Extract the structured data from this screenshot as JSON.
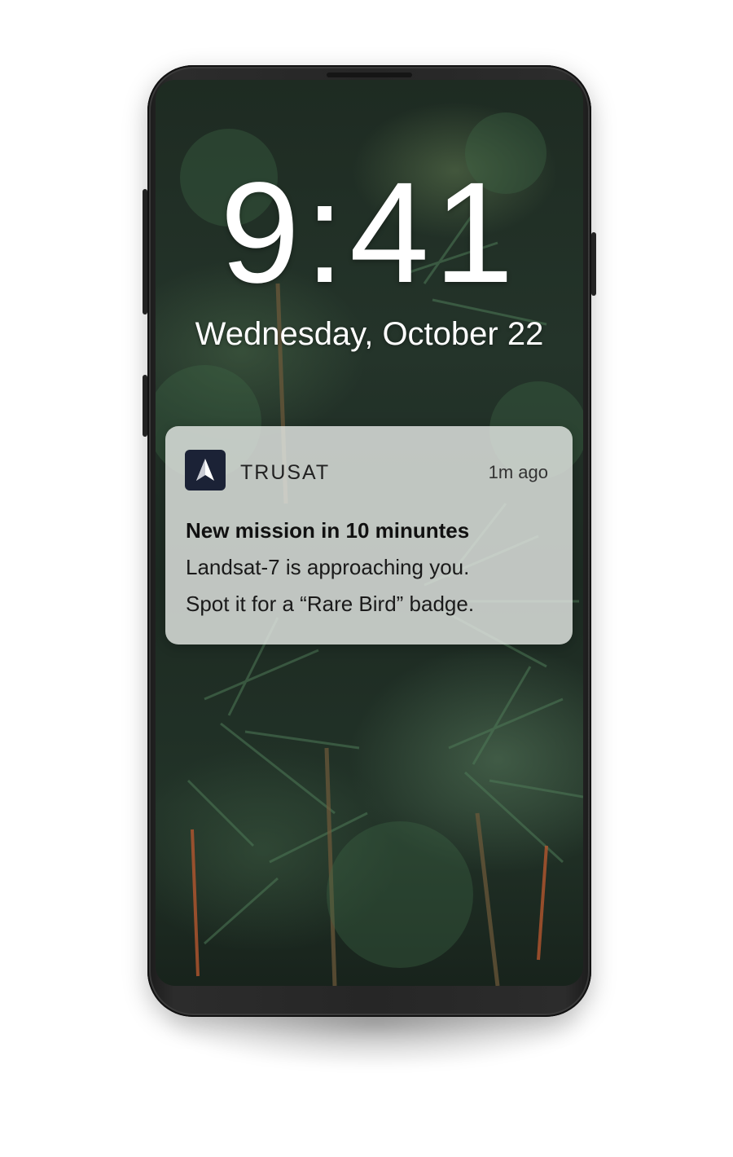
{
  "lock_screen": {
    "time": "9:41",
    "date": "Wednesday, October 22"
  },
  "notification": {
    "app_name": "TRUSAT",
    "time_ago": "1m ago",
    "title": "New mission in 10 minuntes",
    "body_line1": "Landsat-7 is approaching you.",
    "body_line2": "Spot it for a “Rare Bird” badge.",
    "app_icon": "trusat-arrow-icon"
  },
  "colors": {
    "phone_body": "#262626",
    "notification_bg": "#e4e8e4",
    "app_icon_bg": "#1b2236",
    "text_white": "#ffffff"
  }
}
